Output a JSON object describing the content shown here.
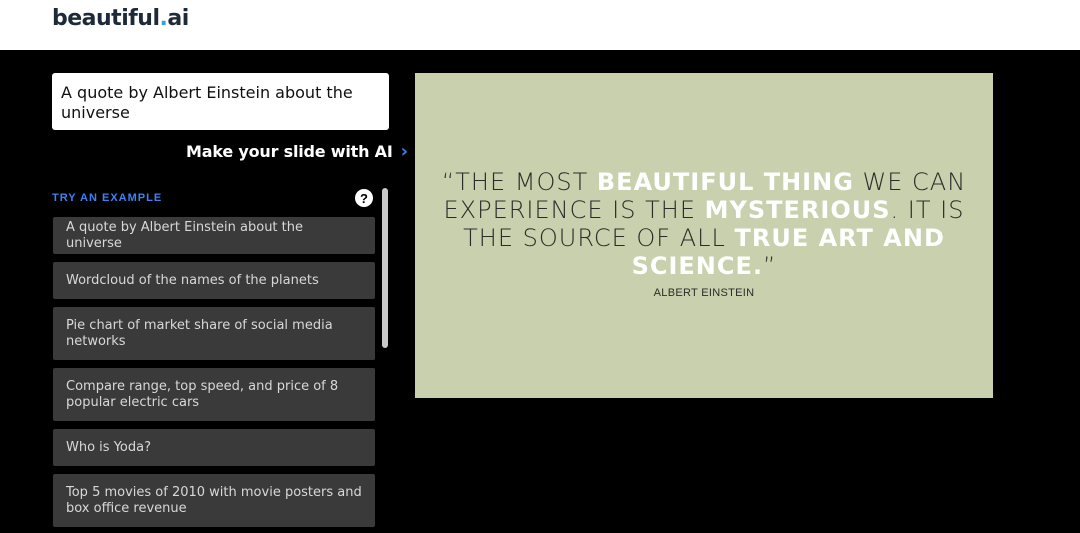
{
  "header": {
    "logo_main": "beautiful",
    "logo_dot": ".",
    "logo_ai": "ai"
  },
  "prompt": {
    "value": "A quote by Albert Einstein about the universe"
  },
  "make_button": {
    "label": "Make your slide with AI",
    "icon": "chevron-right-icon"
  },
  "examples": {
    "heading": "TRY AN EXAMPLE",
    "help_icon": "?",
    "items": [
      "A quote by Albert Einstein about the universe",
      "Wordcloud of the names of the planets",
      "Pie chart of market share of social media networks",
      "Compare range, top speed, and price of 8 popular electric cars",
      "Who is Yoda?",
      "Top 5 movies of 2010 with movie posters and box office revenue"
    ]
  },
  "slide": {
    "quote_parts": [
      "“THE MOST ",
      "BEAUTIFUL THING",
      " WE CAN EXPERIENCE IS THE ",
      "MYSTERIOUS",
      ". IT IS THE SOURCE OF ALL ",
      "TRUE ART AND SCIENCE.",
      "”"
    ],
    "author": "ALBERT EINSTEIN",
    "background_color": "#c8d0ad",
    "highlight_color": "#ffffff"
  },
  "colors": {
    "accent": "#3b82f6",
    "example_bg": "#3a3a3a",
    "page_bg": "#000000"
  }
}
